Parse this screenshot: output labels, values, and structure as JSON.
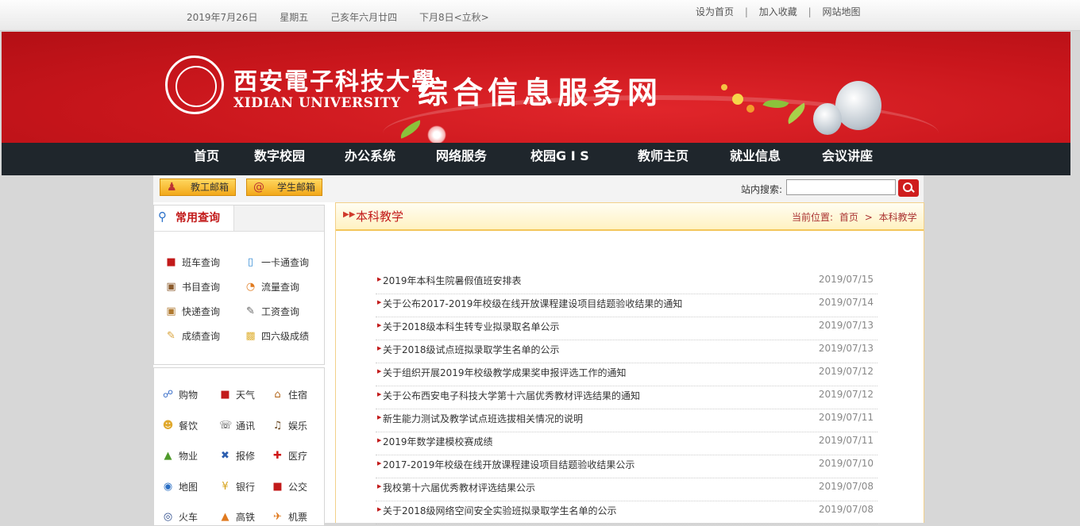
{
  "topbar": {
    "date": "2019年7月26日",
    "weekday": "星期五",
    "lunar": "己亥年六月廿四",
    "solar_term": "下月8日<立秋>",
    "links": [
      "设为首页",
      "加入收藏",
      "网站地图"
    ]
  },
  "banner": {
    "university_cn": "西安電子科技大學",
    "university_en": "XIDIAN UNIVERSITY",
    "site_title": "综合信息服务网"
  },
  "nav": [
    "首页",
    "数字校园",
    "办公系统",
    "网络服务",
    "校园G I S",
    "教师主页",
    "就业信息",
    "会议讲座"
  ],
  "toolbar": {
    "staff_mail": "教工邮箱",
    "student_mail": "学生邮箱",
    "search_label": "站内搜索:",
    "search_value": ""
  },
  "query_panel": {
    "title": "常用查询",
    "items": [
      {
        "label": "班车查询",
        "icon": "bus-icon"
      },
      {
        "label": "一卡通查询",
        "icon": "card-icon"
      },
      {
        "label": "书目查询",
        "icon": "book-icon"
      },
      {
        "label": "流量查询",
        "icon": "pie-icon"
      },
      {
        "label": "快递查询",
        "icon": "truck-icon"
      },
      {
        "label": "工资查询",
        "icon": "wallet-icon"
      },
      {
        "label": "成绩查询",
        "icon": "pencil-icon"
      },
      {
        "label": "四六级成绩",
        "icon": "note-icon"
      }
    ]
  },
  "life_panel": {
    "items": [
      {
        "label": "购物",
        "icon": "cart-icon"
      },
      {
        "label": "天气",
        "icon": "weather-icon"
      },
      {
        "label": "住宿",
        "icon": "house-icon"
      },
      {
        "label": "餐饮",
        "icon": "food-icon"
      },
      {
        "label": "通讯",
        "icon": "phone-icon"
      },
      {
        "label": "娱乐",
        "icon": "music-icon"
      },
      {
        "label": "物业",
        "icon": "tree-icon"
      },
      {
        "label": "报修",
        "icon": "tools-icon"
      },
      {
        "label": "医疗",
        "icon": "cross-icon"
      },
      {
        "label": "地图",
        "icon": "globe-icon"
      },
      {
        "label": "银行",
        "icon": "money-icon"
      },
      {
        "label": "公交",
        "icon": "bus-icon"
      },
      {
        "label": "火车",
        "icon": "train-icon"
      },
      {
        "label": "高铁",
        "icon": "rail-icon"
      },
      {
        "label": "机票",
        "icon": "plane-icon"
      }
    ]
  },
  "content": {
    "section_title": "本科教学",
    "breadcrumb_prefix": "当前位置:",
    "breadcrumb": [
      "首页",
      "本科教学"
    ],
    "news": [
      {
        "title": "2019年本科生院暑假值班安排表",
        "date": "2019/07/15"
      },
      {
        "title": "关于公布2017-2019年校级在线开放课程建设项目结题验收结果的通知",
        "date": "2019/07/14"
      },
      {
        "title": "关于2018级本科生转专业拟录取名单公示",
        "date": "2019/07/13"
      },
      {
        "title": "关于2018级试点班拟录取学生名单的公示",
        "date": "2019/07/13"
      },
      {
        "title": "关于组织开展2019年校级教学成果奖申报评选工作的通知",
        "date": "2019/07/12"
      },
      {
        "title": "关于公布西安电子科技大学第十六届优秀教材评选结果的通知",
        "date": "2019/07/12"
      },
      {
        "title": "新生能力测试及教学试点班选拔相关情况的说明",
        "date": "2019/07/11"
      },
      {
        "title": "2019年数学建模校赛成绩",
        "date": "2019/07/11"
      },
      {
        "title": "2017-2019年校级在线开放课程建设项目结题验收结果公示",
        "date": "2019/07/10"
      },
      {
        "title": "我校第十六届优秀教材评选结果公示",
        "date": "2019/07/08"
      },
      {
        "title": "关于2018级网络空间安全实验班拟录取学生名单的公示",
        "date": "2019/07/08"
      }
    ]
  },
  "colors": {
    "banner_red": "#c9161c",
    "nav_dark": "#1f262c",
    "accent_red": "#c21a1a",
    "mail_button": "#f2a81a"
  }
}
